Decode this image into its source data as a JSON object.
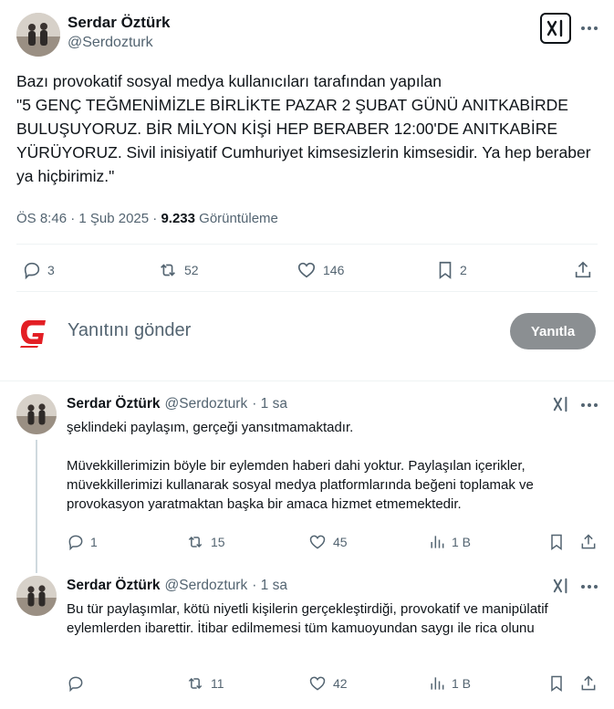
{
  "main_tweet": {
    "author_name": "Serdar Öztürk",
    "author_handle": "@Serdozturk",
    "text": "Bazı provokatif sosyal medya kullanıcıları tarafından yapılan\n\"5 GENÇ TEĞMENİMİZLE BİRLİKTE PAZAR 2 ŞUBAT GÜNÜ ANITKABİRDE BULUŞUYORUZ. BİR MİLYON KİŞİ HEP BERABER 12:00'DE ANITKABİRE YÜRÜYORUZ. Sivil inisiyatif Cumhuriyet kimsesizlerin kimsesidir. Ya hep beraber ya hiçbirimiz.\"",
    "time": "ÖS 8:46 · 1 Şub 2025 ·",
    "views_count": "9.233",
    "views_label": "Görüntüleme",
    "replies": "3",
    "reposts": "52",
    "likes": "146",
    "bookmarks": "2"
  },
  "reply_box": {
    "placeholder": "Yanıtını gönder",
    "button_label": "Yanıtla",
    "logo_letter": "G"
  },
  "replies": [
    {
      "author_name": "Serdar Öztürk",
      "author_handle": "@Serdozturk",
      "time": "· 1 sa",
      "text": "şeklindeki paylaşım, gerçeği yansıtmamaktadır.\n\nMüvekkillerimizin böyle bir eylemden haberi dahi yoktur. Paylaşılan içerikler, müvekkillerimizi kullanarak sosyal medya platformlarında beğeni toplamak ve provokasyon yaratmaktan başka bir amaca hizmet etmemektedir.",
      "replies": "1",
      "reposts": "15",
      "likes": "45",
      "views": "1 B"
    },
    {
      "author_name": "Serdar Öztürk",
      "author_handle": "@Serdozturk",
      "time": "· 1 sa",
      "text": "Bu tür paylaşımlar, kötü niyetli kişilerin gerçekleştirdiği, provokatif ve manipülatif eylemlerden ibarettir. İtibar edilmemesi tüm kamuoyundan saygı ile rica olunu",
      "replies": "",
      "reposts": "11",
      "likes": "42",
      "views": "1 B"
    }
  ]
}
